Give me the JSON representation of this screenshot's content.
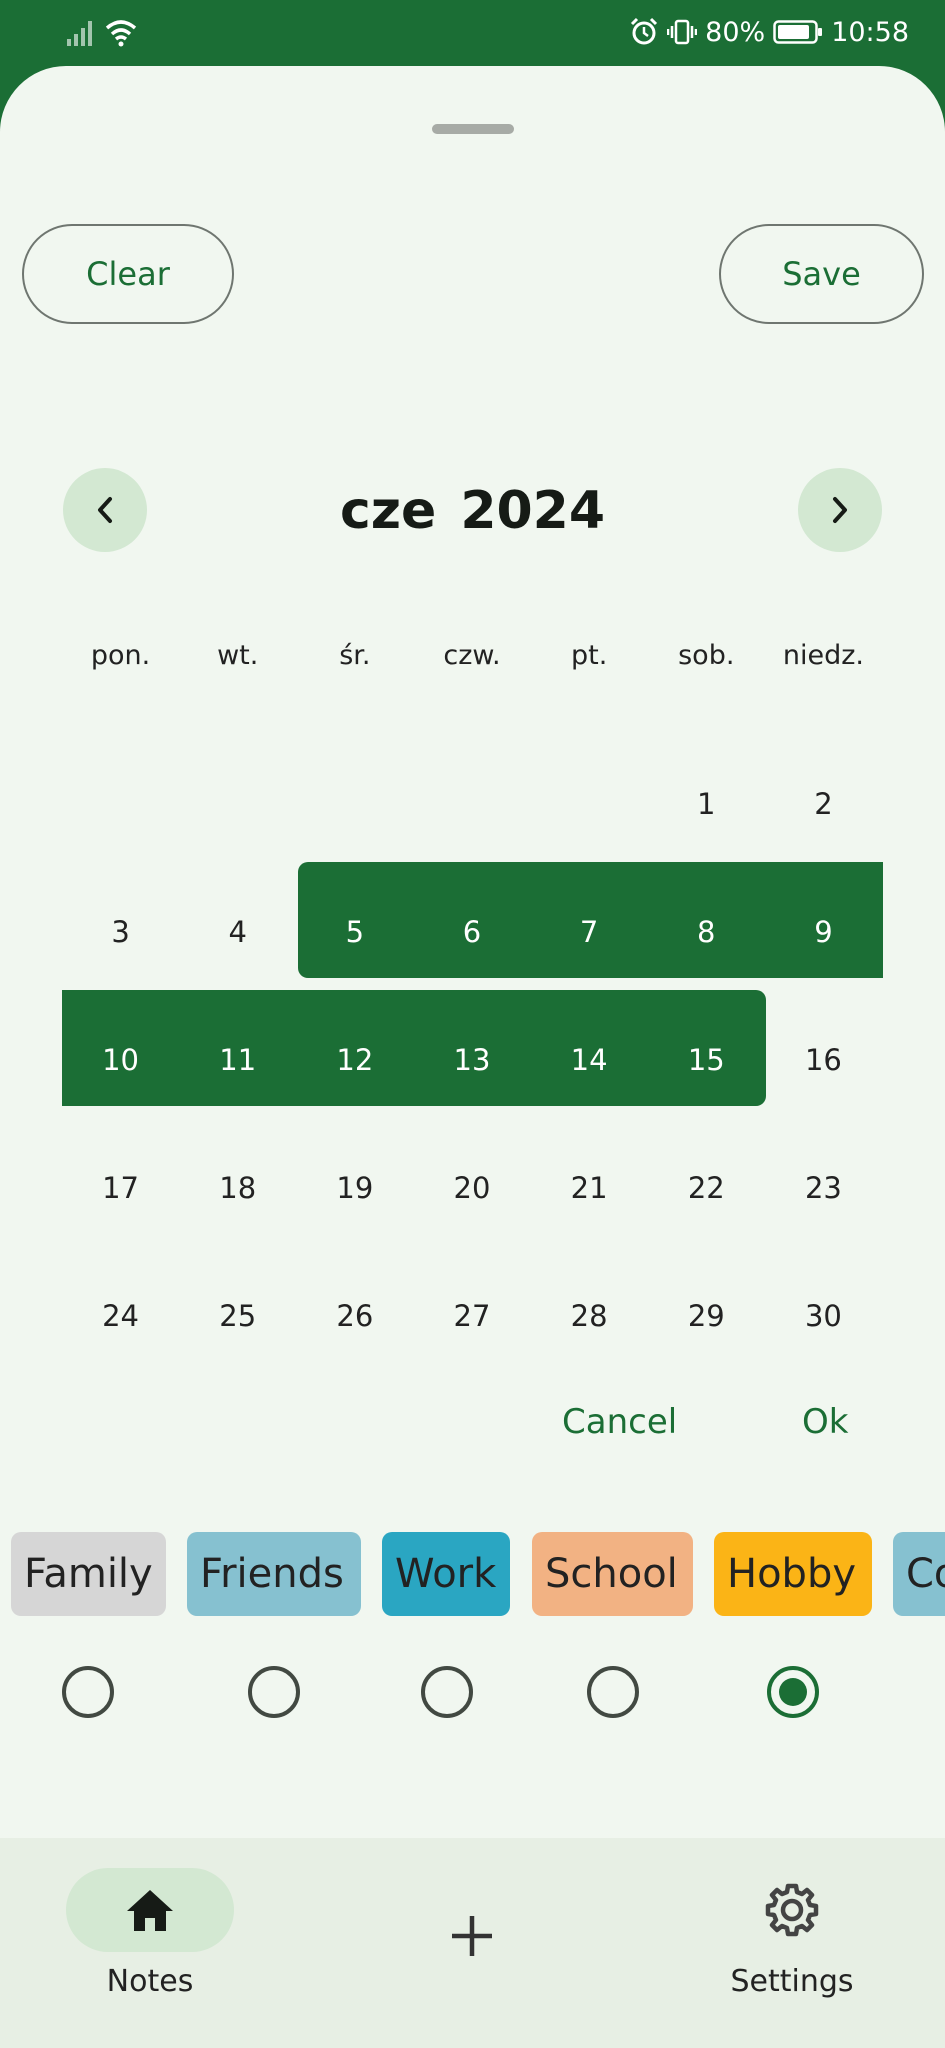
{
  "status_bar": {
    "battery": "80%",
    "time": "10:58"
  },
  "actions": {
    "clear": "Clear",
    "save": "Save"
  },
  "calendar": {
    "month": "cze",
    "year": "2024",
    "weekdays": [
      "pon.",
      "wt.",
      "śr.",
      "czw.",
      "pt.",
      "sob.",
      "niedz."
    ],
    "weeks": [
      [
        "",
        "",
        "",
        "",
        "",
        "1",
        "2"
      ],
      [
        "3",
        "4",
        "5",
        "6",
        "7",
        "8",
        "9"
      ],
      [
        "10",
        "11",
        "12",
        "13",
        "14",
        "15",
        "16"
      ],
      [
        "17",
        "18",
        "19",
        "20",
        "21",
        "22",
        "23"
      ],
      [
        "24",
        "25",
        "26",
        "27",
        "28",
        "29",
        "30"
      ]
    ],
    "range_start": "5",
    "range_end": "15",
    "cancel": "Cancel",
    "ok": "Ok"
  },
  "categories": [
    {
      "label": "Family",
      "color": "#d6d6d6"
    },
    {
      "label": "Friends",
      "color": "#86c1d0"
    },
    {
      "label": "Work",
      "color": "#2aa6c2"
    },
    {
      "label": "School",
      "color": "#f2b283"
    },
    {
      "label": "Hobby",
      "color": "#fbb416"
    },
    {
      "label": "Co",
      "color": "#86c1d0"
    }
  ],
  "selected_option_index": 4,
  "bottom_nav": {
    "notes": "Notes",
    "settings": "Settings"
  },
  "colors": {
    "primary": "#1b6e35",
    "background": "#f1f7f0",
    "accent_container": "#d3e8d2"
  }
}
